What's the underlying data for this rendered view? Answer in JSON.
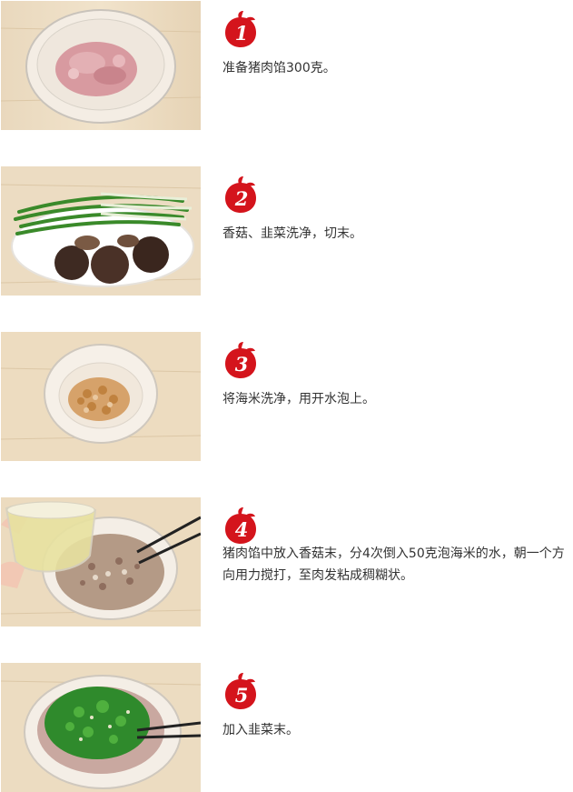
{
  "steps": [
    {
      "number": "1",
      "text": "准备猪肉馅300克。",
      "image": "ground-pork-in-glass-bowl"
    },
    {
      "number": "2",
      "text": "香菇、韭菜洗净，切末。",
      "image": "chives-and-mushrooms-on-plate"
    },
    {
      "number": "3",
      "text": "将海米洗净，用开水泡上。",
      "image": "dried-shrimp-in-glass-bowl"
    },
    {
      "number": "4",
      "text": "猪肉馅中放入香菇末，分4次倒入50克泡海米的水，朝一个方向用力搅打，至肉发粘成稠糊状。",
      "image": "pouring-water-into-filling"
    },
    {
      "number": "5",
      "text": "加入韭菜末。",
      "image": "chopped-chives-added-to-filling"
    }
  ],
  "colors": {
    "badge_red": "#d4141c",
    "text": "#333333"
  }
}
